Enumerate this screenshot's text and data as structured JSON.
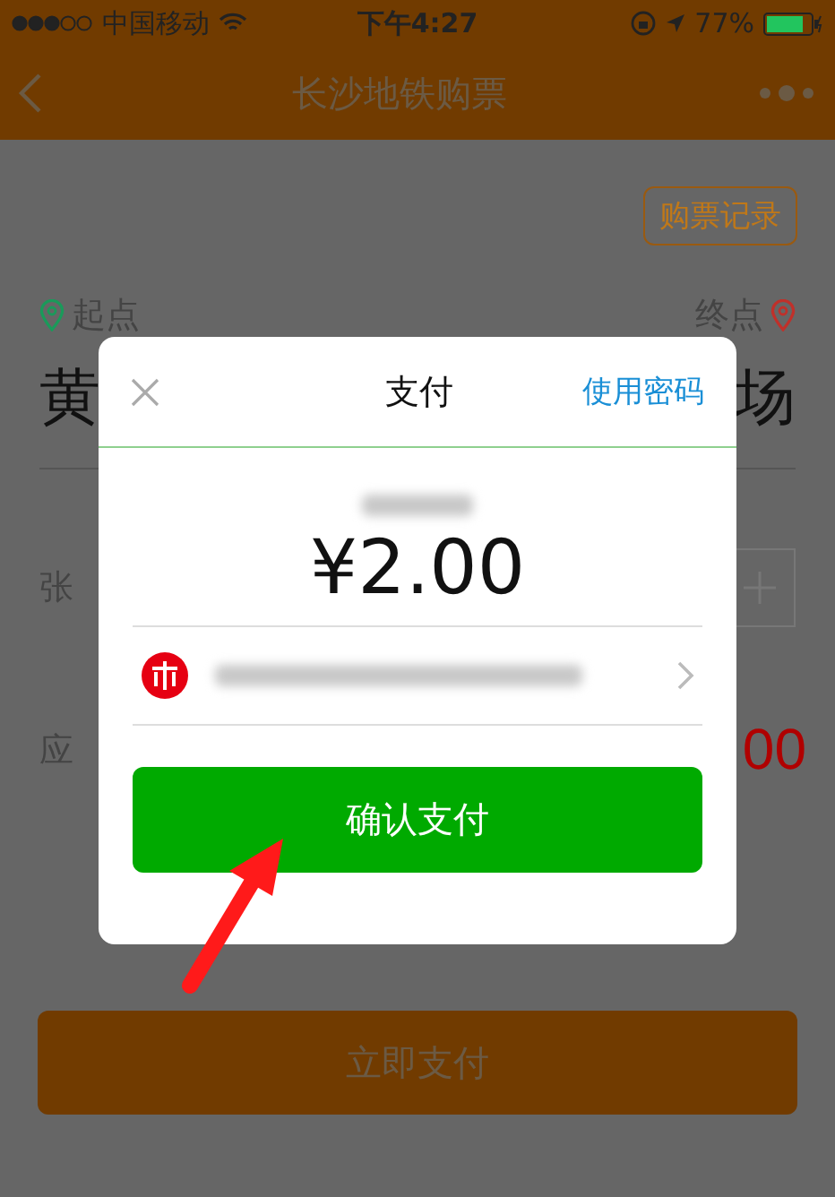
{
  "status_bar": {
    "carrier": "中国移动",
    "time": "下午4:27",
    "battery": "77%"
  },
  "nav_bar": {
    "title": "长沙地铁购票"
  },
  "page": {
    "history_button": "购票记录",
    "origin_label": "起点",
    "destination_label": "终点",
    "origin_station": "黄",
    "destination_station": "场",
    "quantity_label": "张",
    "amount_label": "应",
    "amount_value": "00",
    "pay_button": "立即支付"
  },
  "dialog": {
    "title": "支付",
    "password_link": "使用密码",
    "amount": "¥2.00",
    "confirm_button": "确认支付"
  }
}
